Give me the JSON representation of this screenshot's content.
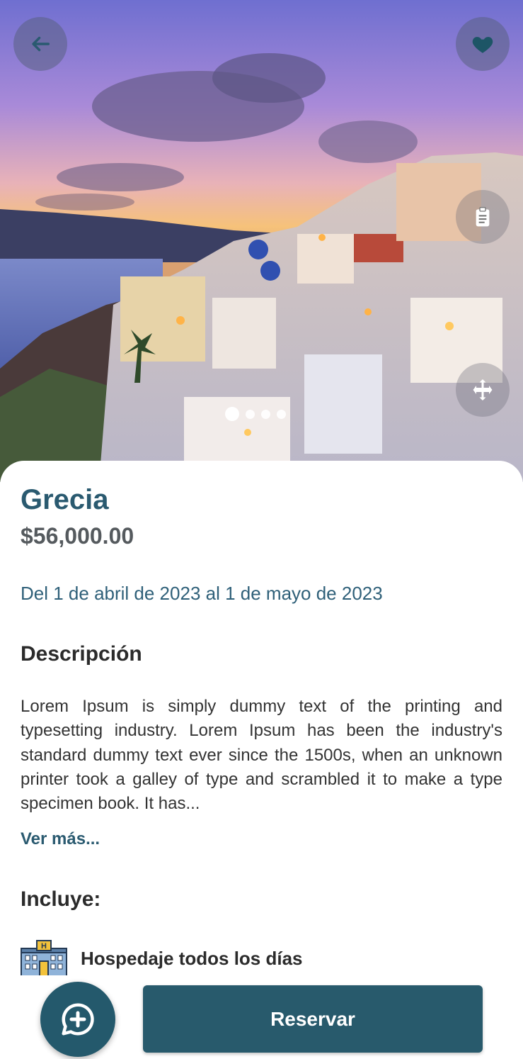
{
  "destination": {
    "title": "Grecia",
    "price": "$56,000.00",
    "dates": "Del 1 de abril de 2023 al 1 de mayo de 2023"
  },
  "description": {
    "heading": "Descripción",
    "text": "Lorem Ipsum is simply dummy text of the printing and typesetting industry. Lorem Ipsum has been the industry's standard dummy text ever since the 1500s, when an unknown printer took a galley of type and scrambled it to make a type specimen book. It has...",
    "more_label": "Ver más..."
  },
  "includes": {
    "heading": "Incluye:",
    "items": [
      {
        "icon": "hotel-icon",
        "label": "Hospedaje todos los días"
      }
    ]
  },
  "gallery": {
    "image": "santorini-sunset-photo",
    "page_count": 4,
    "current_page": 1
  },
  "actions": {
    "reserve_label": "Reservar",
    "chat_icon": "chat-add-icon",
    "back_icon": "back-arrow-icon",
    "favorite_icon": "heart-icon",
    "details_icon": "clipboard-icon",
    "move_icon": "move-icon"
  },
  "colors": {
    "primary": "#285a6c",
    "title": "#2a5a70",
    "price": "#555a5e"
  }
}
